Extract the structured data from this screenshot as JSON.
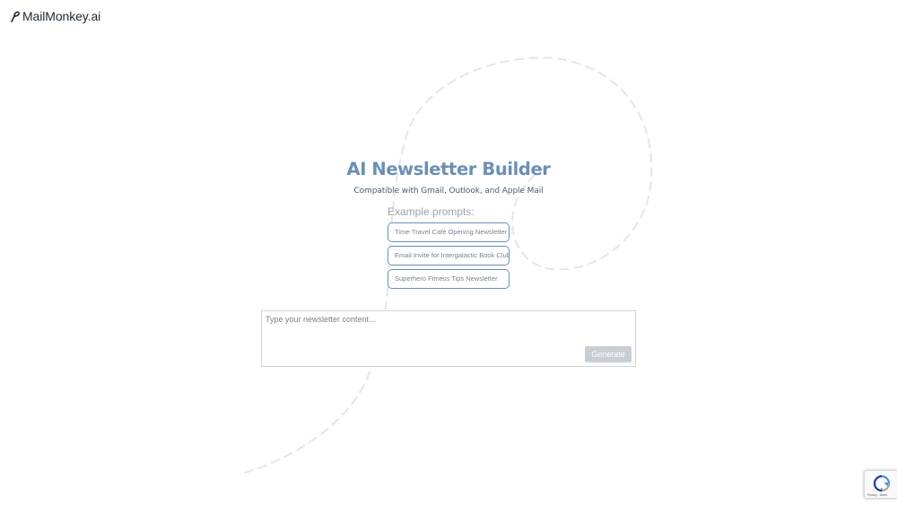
{
  "brand": {
    "name": "MailMonkey.ai",
    "icon": "monkey-tail-icon",
    "color": "#1f2833"
  },
  "hero": {
    "title": "AI Newsletter Builder",
    "subtitle": "Compatible with Gmail, Outlook, and Apple Mail"
  },
  "prompts": {
    "label": "Example prompts:",
    "items": [
      "Time-Travel Café Opening Newsletter",
      "Email Invite for Intergalactic Book Club",
      "Superhero Fitness Tips Newsletter"
    ]
  },
  "editor": {
    "placeholder": "Type your newsletter content...",
    "value": "",
    "generate_label": "Generate"
  },
  "recaptcha": {
    "icon": "recaptcha-icon",
    "privacy": "Privacy",
    "terms": "Terms"
  },
  "colors": {
    "accent": "#6b8fb6",
    "button_disabled": "#c8ced4",
    "decor_dash": "#e3e6ea"
  }
}
